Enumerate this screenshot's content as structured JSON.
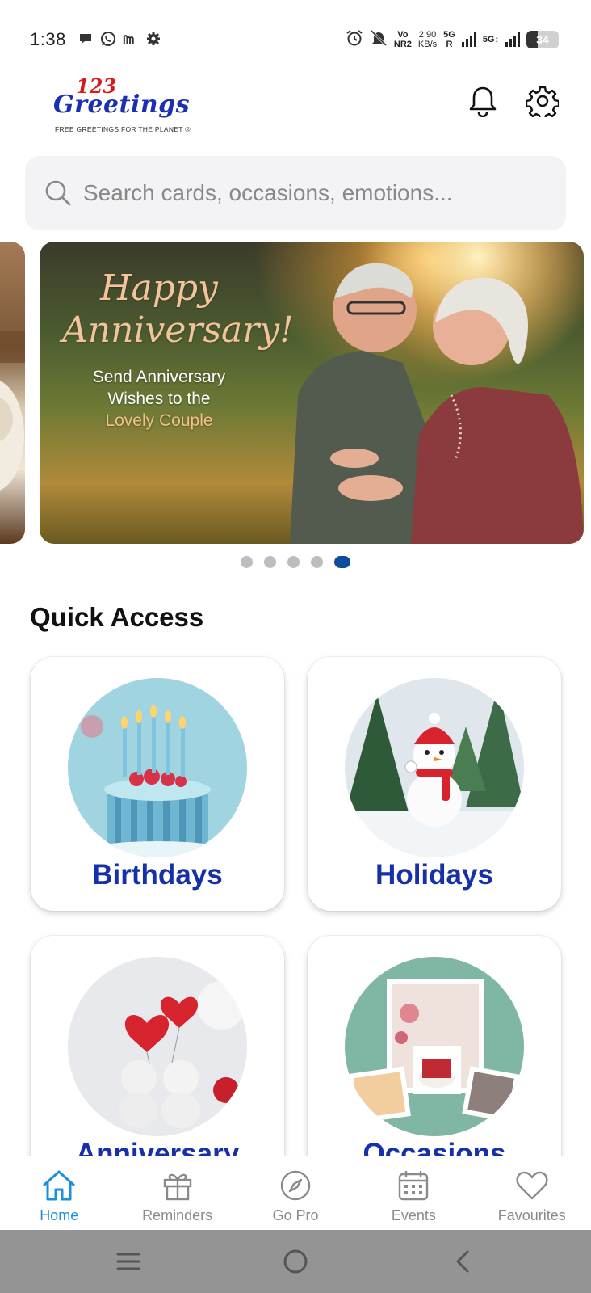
{
  "status_bar": {
    "time": "1:38",
    "net_top": "Vo",
    "net_bottom": "NR2",
    "speed_top": "2.90",
    "speed_bottom": "KB/s",
    "g1_top": "5G",
    "g1_bottom": "R",
    "g2_top": "5G↕",
    "battery": "34"
  },
  "header": {
    "logo_number": "123",
    "logo_word": "Greetings",
    "logo_tagline": "FREE GREETINGS FOR THE PLANET ®"
  },
  "search": {
    "placeholder": "Search cards, occasions, emotions..."
  },
  "banner": {
    "title_line1": "Happy",
    "title_line2": "Anniversary!",
    "sub_line1": "Send Anniversary",
    "sub_line2": "Wishes to the",
    "sub_line3": "Lovely Couple",
    "slides_total": 5,
    "active_slide": 5
  },
  "quick_access": {
    "title": "Quick Access",
    "items": [
      {
        "label": "Birthdays"
      },
      {
        "label": "Holidays"
      },
      {
        "label": "Anniversary"
      },
      {
        "label": "Occasions"
      }
    ]
  },
  "bottom_nav": {
    "items": [
      {
        "label": "Home",
        "icon": "home-icon",
        "active": true
      },
      {
        "label": "Reminders",
        "icon": "gift-icon",
        "active": false
      },
      {
        "label": "Go Pro",
        "icon": "compass-icon",
        "active": false
      },
      {
        "label": "Events",
        "icon": "calendar-icon",
        "active": false
      },
      {
        "label": "Favourites",
        "icon": "heart-icon",
        "active": false
      }
    ]
  },
  "colors": {
    "brand_blue": "#1530a8",
    "nav_active": "#1a8fe0",
    "dot_active": "#0c4c9a",
    "logo_red": "#d61b1b"
  }
}
